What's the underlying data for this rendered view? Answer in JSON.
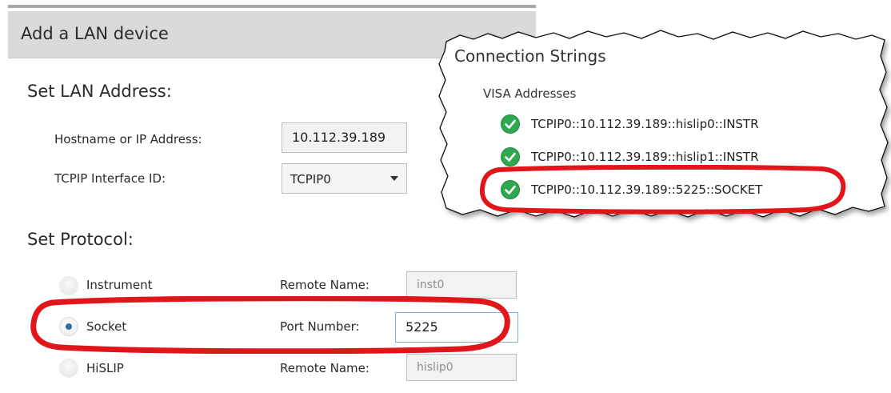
{
  "panel": {
    "title": "Add a LAN device"
  },
  "lan": {
    "section_title": "Set LAN Address:",
    "hostname_label": "Hostname or IP Address:",
    "hostname_value": "10.112.39.189",
    "interface_label": "TCPIP Interface ID:",
    "interface_value": "TCPIP0"
  },
  "protocol": {
    "section_title": "Set Protocol:",
    "options": [
      {
        "label": "Instrument",
        "field_label": "Remote Name:",
        "field_value": "inst0",
        "selected": false
      },
      {
        "label": "Socket",
        "field_label": "Port Number:",
        "field_value": "5225",
        "selected": true
      },
      {
        "label": "HiSLIP",
        "field_label": "Remote Name:",
        "field_value": "hislip0",
        "selected": false
      }
    ]
  },
  "connection_strings": {
    "title": "Connection Strings",
    "subtitle": "VISA Addresses",
    "addresses": [
      "TCPIP0::10.112.39.189::hislip0::INSTR",
      "TCPIP0::10.112.39.189::hislip1::INSTR",
      "TCPIP0::10.112.39.189::5225::SOCKET"
    ]
  },
  "colors": {
    "highlight": "#e0161b",
    "check": "#2fa84f",
    "radio_dot": "#2e6ea0",
    "header_bg": "#dadada"
  },
  "icons": {
    "status": "check-circle-icon",
    "dropdown": "chevron-down-icon"
  }
}
